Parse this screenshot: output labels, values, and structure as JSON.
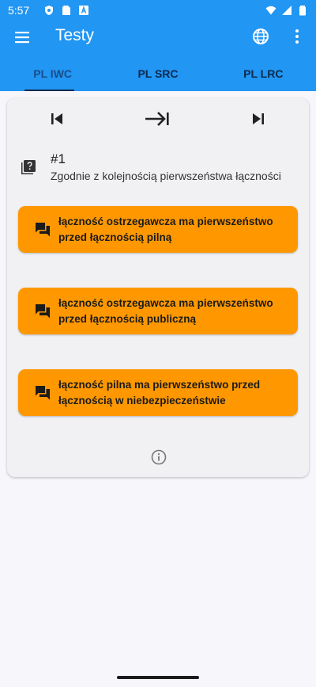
{
  "status_bar": {
    "time": "5:57"
  },
  "app_bar": {
    "title": "Testy"
  },
  "tabs": [
    {
      "label": "PL IWC",
      "active": true
    },
    {
      "label": "PL SRC",
      "active": false
    },
    {
      "label": "PL LRC",
      "active": false
    }
  ],
  "question": {
    "number": "#1",
    "text": "Zgodnie z kolejnością pierwszeństwa łączności"
  },
  "answers": [
    {
      "text": "łączność ostrzegawcza ma pierwszeństwo przed łącznością pilną"
    },
    {
      "text": "łączność ostrzegawcza ma pierwszeństwo przed łącznością publiczną"
    },
    {
      "text": "łączność pilna ma pierwszeństwo przed łącznością w niebezpieczeństwie"
    }
  ],
  "colors": {
    "app_bar": "#2196f3",
    "answer_bg": "#ff9800",
    "background": "#f7f7fb"
  },
  "icons": [
    "menu-icon",
    "globe-icon",
    "more-vert-icon",
    "skip-previous-icon",
    "next-arrow-icon",
    "skip-next-icon",
    "quiz-icon",
    "forum-icon",
    "info-icon"
  ]
}
